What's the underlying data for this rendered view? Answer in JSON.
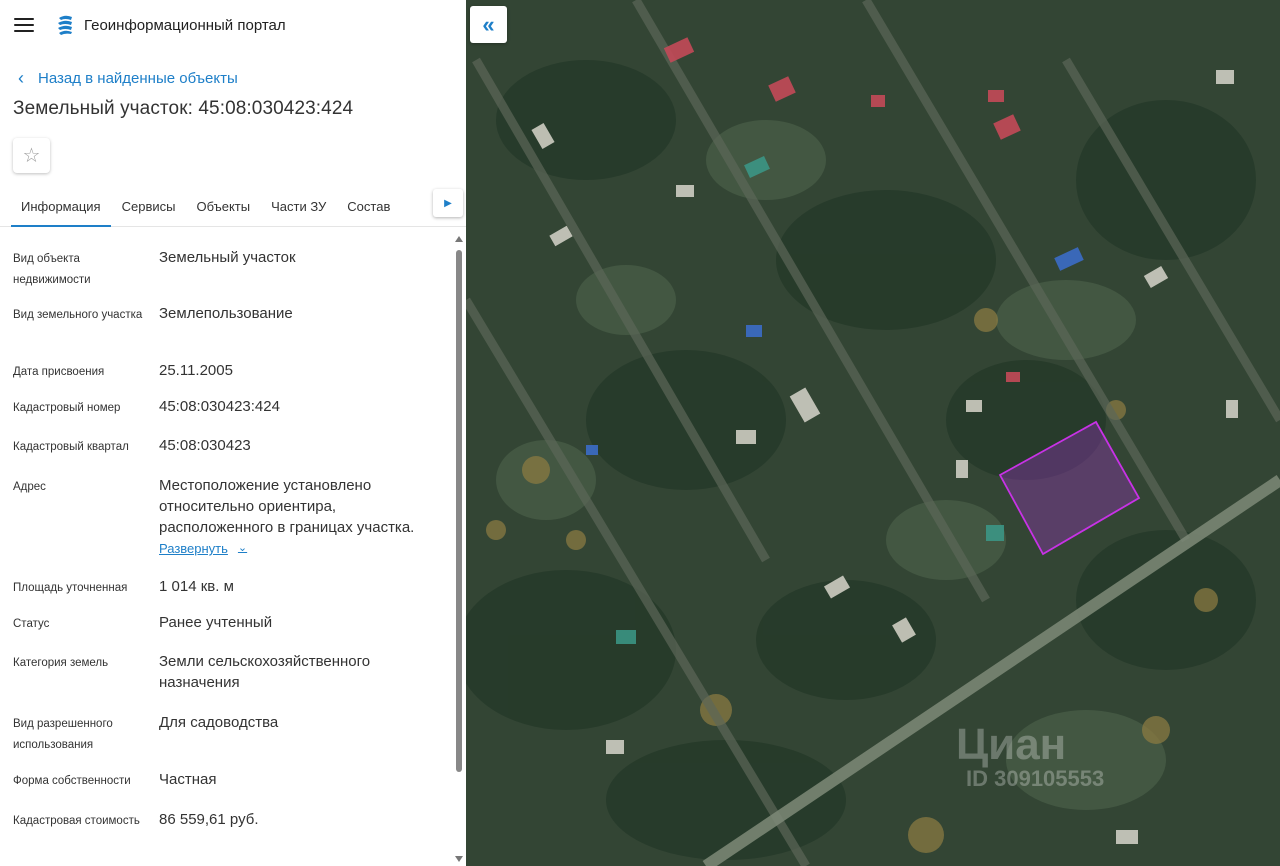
{
  "header": {
    "title": "Геоинформационный портал"
  },
  "back_link": "Назад в найденные объекты",
  "object_title": "Земельный участок: 45:08:030423:424",
  "tabs": [
    {
      "label": "Информация",
      "active": true
    },
    {
      "label": "Сервисы"
    },
    {
      "label": "Объекты"
    },
    {
      "label": "Части ЗУ"
    },
    {
      "label": "Состав"
    }
  ],
  "properties": [
    {
      "label": "Вид объекта недвижимости",
      "value": "Земельный участок"
    },
    {
      "label": "Вид земельного участка",
      "value": "Землепользование"
    },
    {
      "label": "Дата присвоения",
      "value": "25.11.2005"
    },
    {
      "label": "Кадастровый номер",
      "value": "45:08:030423:424"
    },
    {
      "label": "Кадастровый квартал",
      "value": "45:08:030423"
    },
    {
      "label": "Адрес",
      "value": "Местоположение установлено относительно ориентира, расположенного в границах участка.",
      "expand": "Развернуть"
    },
    {
      "label": "Площадь уточненная",
      "value": "1 014 кв. м"
    },
    {
      "label": "Статус",
      "value": "Ранее учтенный"
    },
    {
      "label": "Категория земель",
      "value": "Земли сельскохозяйственного назначения"
    },
    {
      "label": "Вид разрешенного использования",
      "value": "Для садоводства"
    },
    {
      "label": "Форма собственности",
      "value": "Частная"
    },
    {
      "label": "Кадастровая стоимость",
      "value": "86 559,61 руб."
    }
  ],
  "map": {
    "collapse_icon": "«",
    "watermark": "Циан",
    "watermark_id": "ID 309105553",
    "parcel_color": "#c832e6"
  }
}
